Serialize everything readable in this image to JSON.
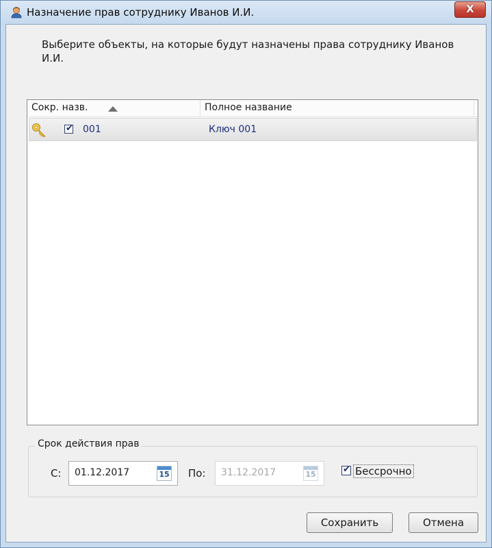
{
  "window": {
    "title": "Назначение прав сотруднику Иванов И.И.",
    "close_symbol": "X"
  },
  "instruction": "Выберите объекты, на которые будут назначены права сотруднику Иванов И.И.",
  "list": {
    "columns": [
      "Сокр. назв.",
      "Полное название"
    ],
    "sort_column": "Сокр. назв.",
    "sort_direction": "ascending",
    "rows": [
      {
        "icon": "key-icon",
        "checked": true,
        "check_symbol": "✔",
        "short_name": "001",
        "full_name": "Ключ 001"
      }
    ]
  },
  "validity": {
    "group_title": "Срок действия прав",
    "from_label": "С:",
    "from_value": "01.12.2017",
    "to_label": "По:",
    "to_value": "31.12.2017",
    "calendar_day": "15",
    "unlimited_label": "Бессрочно",
    "unlimited_checked": true,
    "check_symbol": "✔"
  },
  "buttons": {
    "save": "Сохранить",
    "cancel": "Отмена"
  },
  "colors": {
    "row_text": "#1d2e7a",
    "disabled_text": "#a6a6a6",
    "close_button": "#c9463a"
  }
}
